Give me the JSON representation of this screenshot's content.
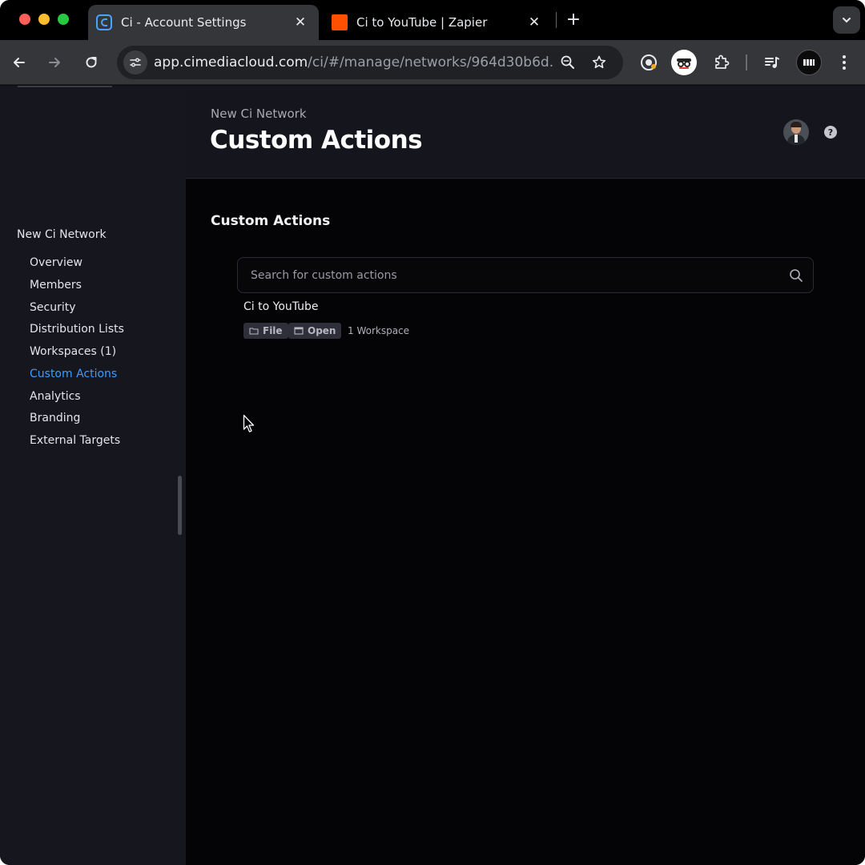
{
  "browser": {
    "tabs": [
      {
        "title": "Ci - Account Settings",
        "active": true,
        "favicon": "ci-logo-icon"
      },
      {
        "title": "Ci to YouTube | Zapier",
        "active": false,
        "favicon": "zapier-icon"
      }
    ],
    "url_host": "app.cimediacloud.com",
    "url_path": "/ci/#/manage/networks/964d30b6d..."
  },
  "sidebar": {
    "heading": "New Ci Network",
    "items": [
      {
        "label": "Overview",
        "active": false
      },
      {
        "label": "Members",
        "active": false
      },
      {
        "label": "Security",
        "active": false
      },
      {
        "label": "Distribution Lists",
        "active": false
      },
      {
        "label": "Workspaces (1)",
        "active": false
      },
      {
        "label": "Custom Actions",
        "active": true
      },
      {
        "label": "Analytics",
        "active": false
      },
      {
        "label": "Branding",
        "active": false
      },
      {
        "label": "External Targets",
        "active": false
      }
    ]
  },
  "header": {
    "breadcrumb": "New Ci Network",
    "title": "Custom Actions"
  },
  "main": {
    "section_title": "Custom Actions",
    "search": {
      "placeholder": "Search for custom actions",
      "value": ""
    },
    "actions": [
      {
        "name": "Ci to YouTube",
        "tags": [
          {
            "label": "File",
            "icon": "folder-icon"
          },
          {
            "label": "Open",
            "icon": "window-icon"
          }
        ],
        "workspaces": "1 Workspace"
      }
    ]
  },
  "colors": {
    "accent": "#3d9cff",
    "sidebar_bg": "#16161f",
    "content_bg": "#040407"
  }
}
